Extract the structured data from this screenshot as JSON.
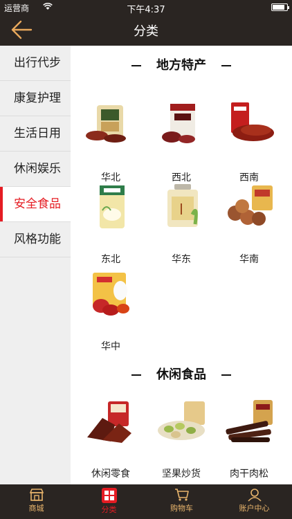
{
  "status_bar": {
    "carrier": "运营商",
    "time": "下午4:37",
    "battery": 0.85
  },
  "nav": {
    "title": "分类",
    "back_icon": "back-arrow-icon"
  },
  "colors": {
    "accent": "#e51c23",
    "gold": "#e9b56c",
    "dark": "#2a2522"
  },
  "sidebar": {
    "items": [
      {
        "label": "出行代步"
      },
      {
        "label": "康复护理"
      },
      {
        "label": "生活日用"
      },
      {
        "label": "休闲娱乐"
      },
      {
        "label": "安全食品",
        "active": true
      },
      {
        "label": "风格功能"
      }
    ]
  },
  "main": {
    "sections": [
      {
        "title": "地方特产",
        "items": [
          {
            "label": "华北"
          },
          {
            "label": "西北"
          },
          {
            "label": "西南"
          },
          {
            "label": "东北"
          },
          {
            "label": "华东"
          },
          {
            "label": "华南"
          },
          {
            "label": "华中"
          }
        ]
      },
      {
        "title": "休闲食品",
        "items": [
          {
            "label": "休闲零食"
          },
          {
            "label": "坚果炒货"
          },
          {
            "label": "肉干肉松"
          }
        ]
      }
    ]
  },
  "tabbar": {
    "items": [
      {
        "label": "商城",
        "icon": "shop-icon"
      },
      {
        "label": "分类",
        "icon": "category-icon",
        "active": true
      },
      {
        "label": "购物车",
        "icon": "cart-icon"
      },
      {
        "label": "账户中心",
        "icon": "account-icon"
      }
    ]
  }
}
